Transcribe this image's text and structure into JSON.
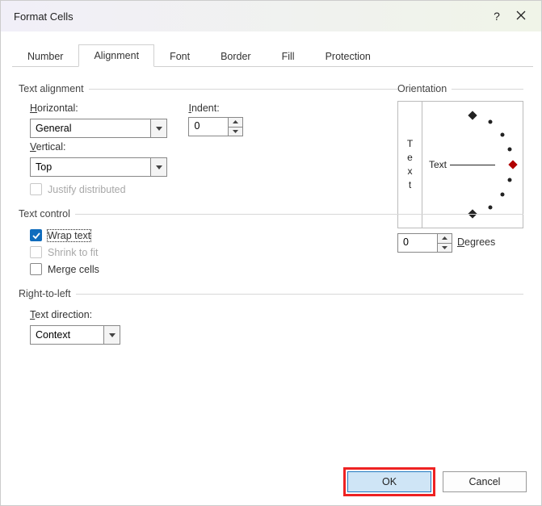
{
  "window": {
    "title": "Format Cells",
    "help_tooltip": "?",
    "close_tooltip": "Close"
  },
  "tabs": {
    "number": "Number",
    "alignment": "Alignment",
    "font": "Font",
    "border": "Border",
    "fill": "Fill",
    "protection": "Protection",
    "active": "alignment"
  },
  "alignment": {
    "section_label": "Text alignment",
    "horizontal_label": "Horizontal:",
    "horizontal_value": "General",
    "vertical_label": "Vertical:",
    "vertical_value": "Top",
    "indent_label": "Indent:",
    "indent_value": "0",
    "justify_distributed_label": "Justify distributed",
    "justify_distributed_checked": false,
    "justify_distributed_enabled": false
  },
  "text_control": {
    "section_label": "Text control",
    "wrap_text_label": "Wrap text",
    "wrap_text_checked": true,
    "shrink_label": "Shrink to fit",
    "shrink_checked": false,
    "shrink_enabled": false,
    "merge_label": "Merge cells",
    "merge_checked": false
  },
  "rtl": {
    "section_label": "Right-to-left",
    "direction_label": "Text direction:",
    "direction_value": "Context"
  },
  "orientation": {
    "section_label": "Orientation",
    "vertical_text": "Text",
    "dial_text": "Text",
    "degrees_value": "0",
    "degrees_label": "Degrees"
  },
  "buttons": {
    "ok": "OK",
    "cancel": "Cancel"
  }
}
